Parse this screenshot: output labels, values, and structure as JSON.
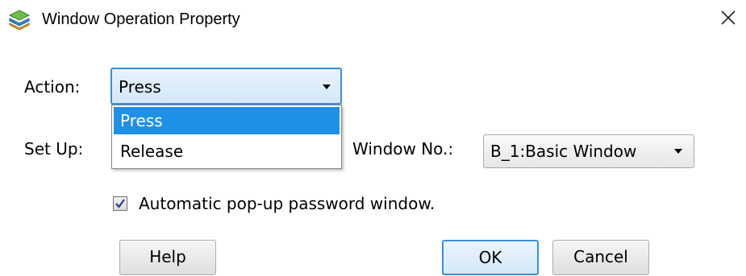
{
  "window": {
    "title": "Window Operation Property",
    "icon": "layers-app-icon",
    "close_icon": "close-icon"
  },
  "form": {
    "action_label": "Action:",
    "action_value": "Press",
    "action_options": [
      "Press",
      "Release"
    ],
    "setup_label": "Set Up:",
    "window_no_label": "Window No.:",
    "window_no_value": "B_1:Basic Window",
    "auto_popup_label": "Automatic pop-up password window.",
    "auto_popup_checked": true
  },
  "buttons": {
    "help": "Help",
    "ok": "OK",
    "cancel": "Cancel"
  },
  "colors": {
    "selection": "#1e90e6",
    "focus_border": "#3c8dd6"
  }
}
